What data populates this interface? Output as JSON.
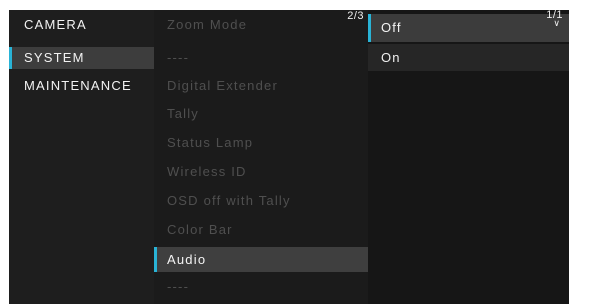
{
  "menu": {
    "categories": [
      {
        "label": "CAMERA"
      },
      {
        "label": "SYSTEM"
      },
      {
        "label": "MAINTENANCE"
      }
    ],
    "system_items": [
      {
        "label": "Zoom Mode"
      },
      {
        "label": "----"
      },
      {
        "label": "Digital Extender"
      },
      {
        "label": "Tally"
      },
      {
        "label": "Status Lamp"
      },
      {
        "label": "Wireless ID"
      },
      {
        "label": "OSD off with Tally"
      },
      {
        "label": "Color Bar"
      },
      {
        "label": "Audio"
      },
      {
        "label": "----"
      }
    ],
    "system_page": "2/3",
    "options": [
      {
        "label": "Off"
      },
      {
        "label": "On"
      }
    ],
    "options_page": "1/1",
    "selected_category": "SYSTEM",
    "selected_item": "Audio",
    "selected_option": "Off",
    "accent_color": "#29b3d6",
    "scroll_icon": "chevron-down-icon"
  }
}
